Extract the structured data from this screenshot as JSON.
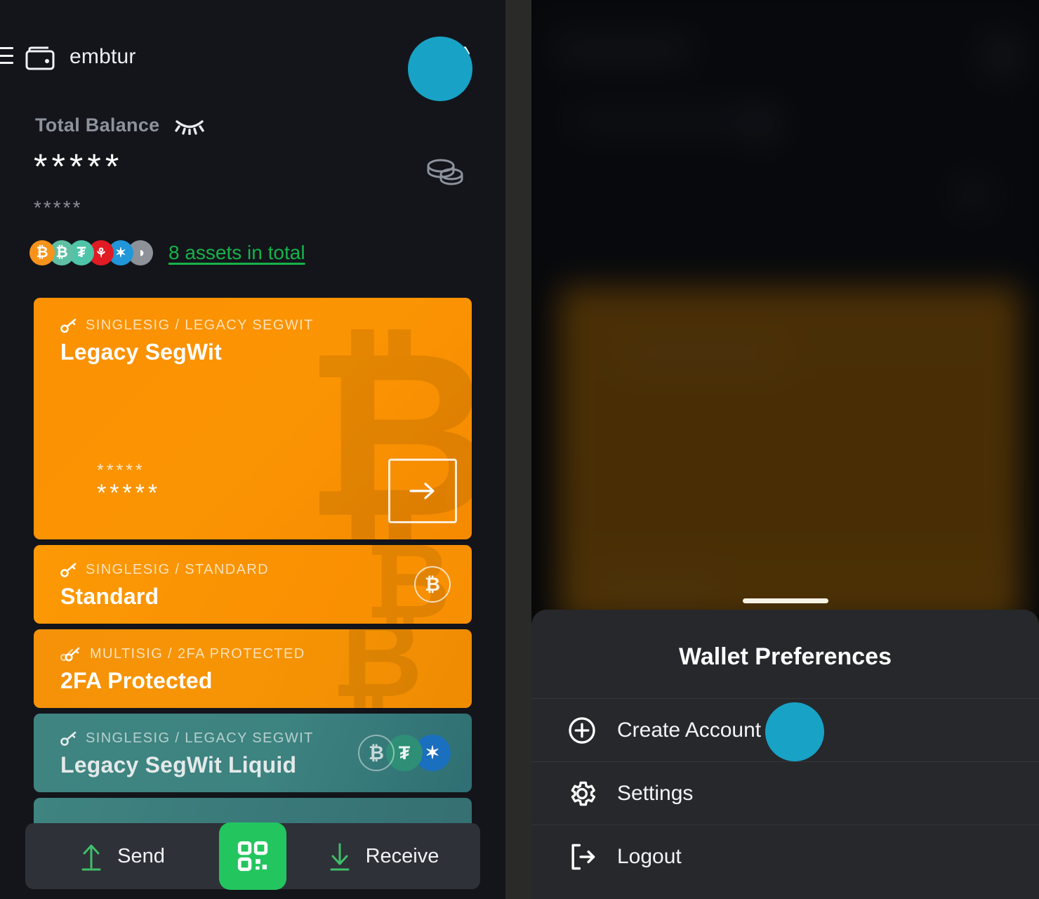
{
  "app": {
    "accent_cyan": "#18a2c6",
    "accent_green": "#17b24a",
    "orange": "#fb9103",
    "teal": "#3f8481"
  },
  "left": {
    "header": {
      "menu_icon": "hamburger-menu-icon",
      "wallet_icon": "wallet-icon",
      "title": "embtur",
      "settings_icon": "gear-icon"
    },
    "balance": {
      "label": "Total Balance",
      "hidden_icon": "eye-closed-icon",
      "primary_value": "*****",
      "secondary_value": "*****",
      "coins_icon": "coins-stack-icon"
    },
    "assets": {
      "link_text": "8 assets in total",
      "bubbles": [
        {
          "name": "bitcoin",
          "symbol": "₿",
          "color": "#f7931a"
        },
        {
          "name": "liquid-bitcoin",
          "symbol": "₿",
          "color": "#5fbfa5"
        },
        {
          "name": "tether",
          "symbol": "₮",
          "color": "#4ec4a8"
        },
        {
          "name": "canadian-dollar",
          "symbol": "☘",
          "color": "#e01b24"
        },
        {
          "name": "liquid",
          "symbol": "✦",
          "color": "#2196d8"
        },
        {
          "name": "other-asset",
          "symbol": "◑",
          "color": "#8d9298"
        }
      ]
    },
    "cards": [
      {
        "meta": "SINGLESIG / LEGACY SEGWIT",
        "key_icon": "key-icon",
        "title": "Legacy SegWit",
        "amount_top": "*****",
        "amount_bottom": "*****",
        "arrow_icon": "arrow-right-icon"
      },
      {
        "meta": "SINGLESIG / STANDARD",
        "key_icon": "key-icon",
        "title": "Standard",
        "icons": [
          {
            "name": "bitcoin-outline",
            "symbol": "₿"
          }
        ]
      },
      {
        "meta": "MULTISIG / 2FA PROTECTED",
        "key_icon": "double-key-icon",
        "title": "2FA Protected",
        "icons": []
      },
      {
        "meta": "SINGLESIG / LEGACY SEGWIT",
        "key_icon": "key-icon",
        "title": "Legacy SegWit Liquid",
        "icons": [
          {
            "name": "liquid-bitcoin-outline",
            "symbol": "₿",
            "color": "transparent"
          },
          {
            "name": "tether-outline",
            "symbol": "₮",
            "color": "#2e8f76"
          },
          {
            "name": "liquid-outline",
            "symbol": "✦",
            "color": "#1a6fbf"
          }
        ]
      }
    ],
    "actions": {
      "send_label": "Send",
      "send_icon": "arrow-up-icon",
      "qr_icon": "qr-code-icon",
      "receive_label": "Receive",
      "receive_icon": "arrow-down-icon"
    }
  },
  "right": {
    "sheet": {
      "grabber": "drag-handle",
      "title": "Wallet Preferences",
      "items": [
        {
          "label": "Create Account",
          "icon": "plus-circle-icon"
        },
        {
          "label": "Settings",
          "icon": "gear-icon"
        },
        {
          "label": "Logout",
          "icon": "logout-icon"
        }
      ]
    }
  }
}
